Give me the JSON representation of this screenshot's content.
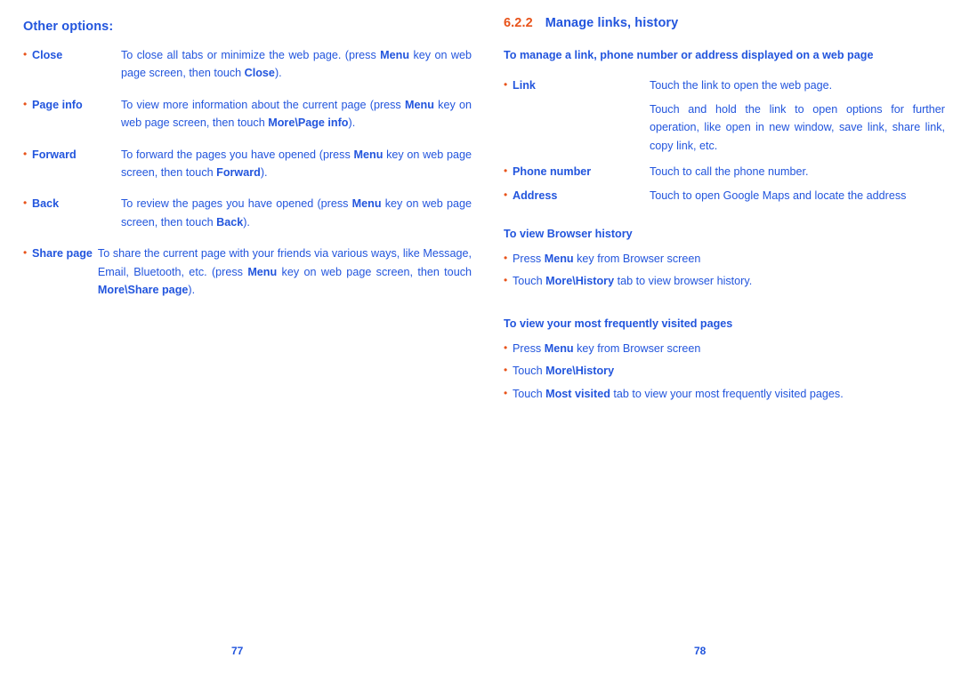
{
  "document": {
    "type": "user-manual-spread",
    "colors": {
      "body_blue": "#2255dd",
      "accent_orange": "#e8531a",
      "background": "#ffffff"
    }
  },
  "left_page": {
    "number": "77",
    "heading": "Other options:",
    "options": [
      {
        "bullet": "•",
        "term": "Close",
        "definition_html": "To close all tabs or minimize the web page. (press <b>Menu</b> key on web page screen, then touch <b>Close</b>)."
      },
      {
        "bullet": "•",
        "term": "Page info",
        "definition_html": "To view more information about the current page (press <b>Menu</b> key on web page screen, then touch <b>More\\Page info</b>)."
      },
      {
        "bullet": "•",
        "term": "Forward",
        "definition_html": "To forward the pages you have opened (press <b>Menu</b> key on web page screen, then touch <b>Forward</b>)."
      },
      {
        "bullet": "•",
        "term": "Back",
        "definition_html": "To review the pages you have opened (press <b>Menu</b> key on web page screen, then touch <b>Back</b>)."
      },
      {
        "bullet": "•",
        "term": "Share page",
        "definition_html": "To share the current page with your friends via various ways, like Message, Email, Bluetooth, etc. (press <b>Menu</b> key on web page screen, then touch <b>More\\Share page</b>)."
      }
    ]
  },
  "right_page": {
    "number": "78",
    "section_number": "6.2.2",
    "section_title": "Manage links, history",
    "manage_heading": "To manage a link, phone number or address displayed on a web page",
    "manage_items": [
      {
        "bullet": "•",
        "term": "Link",
        "definition_html": "Touch the link to open the web page."
      },
      {
        "bullet": "•",
        "term": "",
        "continuation": true,
        "definition_html": "Touch and hold the link to open options for further operation, like open in new window, save link, share link, copy link, etc."
      },
      {
        "bullet": "•",
        "term": "Phone number",
        "definition_html": "Touch to call the phone number."
      },
      {
        "bullet": "•",
        "term": "Address",
        "definition_html": "Touch to open Google Maps and locate the address"
      }
    ],
    "history_heading": "To view Browser history",
    "history_steps": [
      {
        "bullet": "•",
        "text_html": "Press <b>Menu</b> key from Browser screen"
      },
      {
        "bullet": "•",
        "text_html": "Touch <b>More\\History</b> tab to view browser history."
      }
    ],
    "frequent_heading": "To view your most frequently visited pages",
    "frequent_steps": [
      {
        "bullet": "•",
        "text_html": "Press <b>Menu</b> key from Browser screen"
      },
      {
        "bullet": "•",
        "text_html": "Touch <b>More\\History</b>"
      },
      {
        "bullet": "•",
        "text_html": "Touch <b>Most visited</b> tab to view your most frequently visited pages."
      }
    ]
  }
}
